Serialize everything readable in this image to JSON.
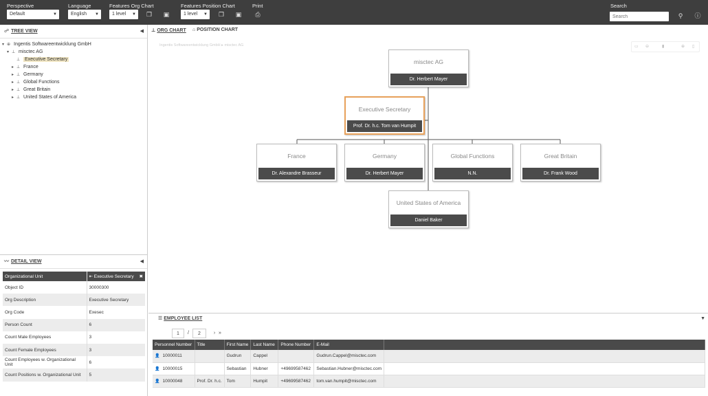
{
  "toolbar": {
    "perspective": {
      "label": "Perspective",
      "value": "Default"
    },
    "language": {
      "label": "Language",
      "value": "English"
    },
    "features_org": {
      "label": "Features Org Chart",
      "value": "1 level"
    },
    "features_pos": {
      "label": "Features Position Chart",
      "value": "1 level"
    },
    "print_label": "Print",
    "search": {
      "label": "Search",
      "placeholder": "Search"
    }
  },
  "tree": {
    "title": "TREE VIEW",
    "root": "Ingentis Softwareentwicklung GmbH",
    "company": "misctec AG",
    "children": [
      "Executive Secretary",
      "France",
      "Germany",
      "Global Functions",
      "Great Britain",
      "United States of America"
    ]
  },
  "detail": {
    "title": "DETAIL VIEW",
    "header_key": "Organizational Unit",
    "header_value": "Executive Secretary",
    "rows": [
      {
        "key": "Object ID",
        "value": "30000300"
      },
      {
        "key": "Org Description",
        "value": "Executive Secretary"
      },
      {
        "key": "Org Code",
        "value": "Exesec"
      },
      {
        "key": "Person Count",
        "value": "6"
      },
      {
        "key": "Count Male Employees",
        "value": "3"
      },
      {
        "key": "Count Female Employees",
        "value": "3"
      },
      {
        "key": "Count Employees w. Organizational Unit",
        "value": "6"
      },
      {
        "key": "Count Positions w. Organizational Unit",
        "value": "5"
      }
    ]
  },
  "tabs": {
    "org_chart": "ORG CHART",
    "position_chart": "POSITION CHART"
  },
  "breadcrumb": "Ingentis Softwareentwicklung GmbH  ▸  misctec AG",
  "org": {
    "top": {
      "title": "misctec AG",
      "person": "Dr. Herbert Mayer"
    },
    "assistant": {
      "title": "Executive Secretary",
      "person": "Prof. Dr. h.c. Tom van Humpit"
    },
    "units": [
      {
        "title": "France",
        "person": "Dr. Alexandre Brasseur"
      },
      {
        "title": "Germany",
        "person": "Dr. Herbert Mayer"
      },
      {
        "title": "Global Functions",
        "person": "N.N."
      },
      {
        "title": "Great Britain",
        "person": "Dr. Frank Wood"
      }
    ],
    "bottom": {
      "title": "United States of America",
      "person": "Daniel Baker"
    }
  },
  "employees": {
    "title": "EMPLOYEE LIST",
    "pager": {
      "current": "1",
      "sep": "/",
      "total": "2"
    },
    "columns": [
      "Personnel Number",
      "Title",
      "First Name",
      "Last Name",
      "Phone Number",
      "E-Mail"
    ],
    "rows": [
      [
        "10000011",
        "",
        "Gudrun",
        "Cappel",
        "",
        "Gudrun.Cappel@misctec.com"
      ],
      [
        "10000015",
        "",
        "Sebastian",
        "Hubner",
        "+49699587462",
        "Sebastian.Hubner@misctec.com"
      ],
      [
        "10000048",
        "Prof. Dr. h.c.",
        "Tom",
        "Humpit",
        "+49699587462",
        "tom.van.humpit@misctec.com"
      ]
    ]
  },
  "colors": {
    "toolbar": "#3e3e3e",
    "highlight": "#e8a15a",
    "person_bar": "#4b4b4b"
  }
}
